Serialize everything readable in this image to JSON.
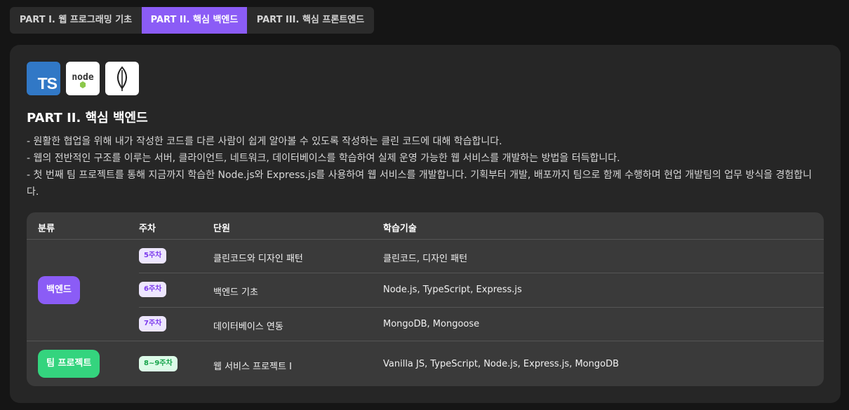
{
  "tabs": [
    {
      "label": "PART I. 웹 프로그래밍 기초",
      "active": false
    },
    {
      "label": "PART II. 핵심 백엔드",
      "active": true
    },
    {
      "label": "PART III. 핵심 프론트엔드",
      "active": false
    }
  ],
  "logos": [
    {
      "name": "typescript-logo",
      "text": "TS"
    },
    {
      "name": "nodejs-logo",
      "text": "node"
    },
    {
      "name": "mongodb-logo",
      "text": ""
    }
  ],
  "section": {
    "title": "PART II. 핵심 백엔드",
    "description": [
      "- 원활한 협업을 위해 내가 작성한 코드를 다른 사람이 쉽게 알아볼 수 있도록 작성하는 클린 코드에 대해 학습합니다.",
      "- 웹의 전반적인 구조를 이루는 서버, 클라이언트, 네트워크, 데이터베이스를 학습하여 실제 운영 가능한 웹 서비스를 개발하는 방법을 터득합니다.",
      "- 첫 번째 팀 프로젝트를 통해 지금까지 학습한 Node.js와 Express.js를 사용하여 웹 서비스를 개발합니다. 기획부터 개발, 배포까지 팀으로 함께 수행하며 현업 개발팀의 업무 방식을 경험합니다."
    ]
  },
  "table": {
    "headers": [
      "분류",
      "주차",
      "단원",
      "학습기술"
    ],
    "groups": [
      {
        "category": "백엔드",
        "rows": [
          {
            "week": "5주차",
            "unit": "클린코드와 디자인 패턴",
            "skills": "클린코드, 디자인 패턴"
          },
          {
            "week": "6주차",
            "unit": "백엔드 기초",
            "skills": "Node.js, TypeScript, Express.js"
          },
          {
            "week": "7주차",
            "unit": "데이터베이스 연동",
            "skills": "MongoDB, Mongoose"
          }
        ]
      },
      {
        "category": "팀 프로젝트",
        "rows": [
          {
            "week": "8~9주차",
            "unit": "웹 서비스 프로젝트 I",
            "skills": "Vanilla JS, TypeScript, Node.js, Express.js, MongoDB"
          }
        ]
      }
    ]
  },
  "colors": {
    "accent": "#8b5cf6",
    "green": "#34d47e",
    "card_bg": "#262626",
    "table_bg": "#3a3a3a"
  }
}
